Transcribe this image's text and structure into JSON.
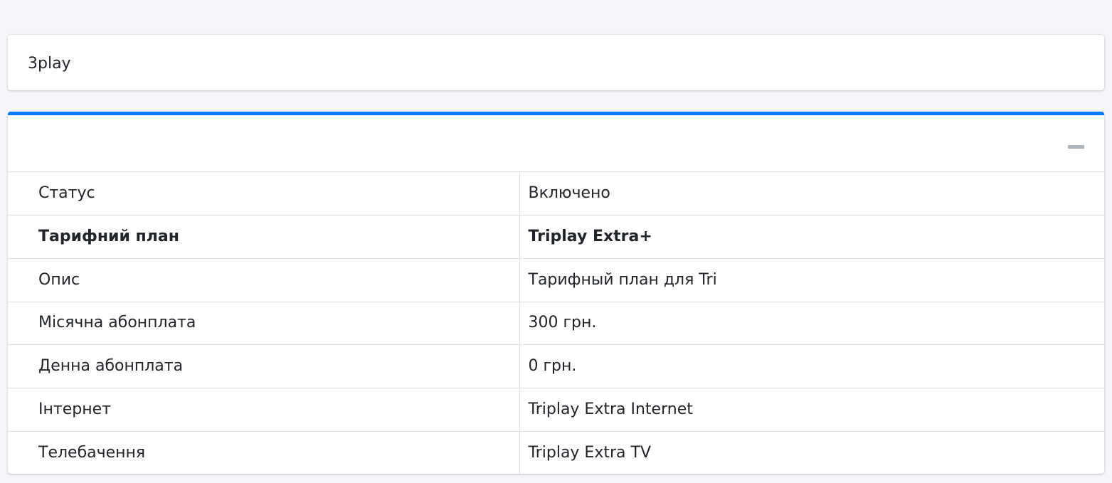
{
  "title_card": {
    "title": "3play"
  },
  "details_card": {
    "accent_color": "#007bff",
    "collapse_icon": "minus-icon",
    "rows": [
      {
        "label": "Статус",
        "value": "Включено",
        "bold": false
      },
      {
        "label": "Тарифний план",
        "value": "Triplay Extra+",
        "bold": true
      },
      {
        "label": "Опис",
        "value": "Тарифный план для Tri",
        "bold": false
      },
      {
        "label": "Місячна абонплата",
        "value": "300 грн.",
        "bold": false
      },
      {
        "label": "Денна абонплата",
        "value": "0 грн.",
        "bold": false
      },
      {
        "label": "Інтернет",
        "value": "Triplay Extra Internet",
        "bold": false
      },
      {
        "label": "Телебачення",
        "value": "Triplay Extra TV",
        "bold": false
      }
    ]
  }
}
